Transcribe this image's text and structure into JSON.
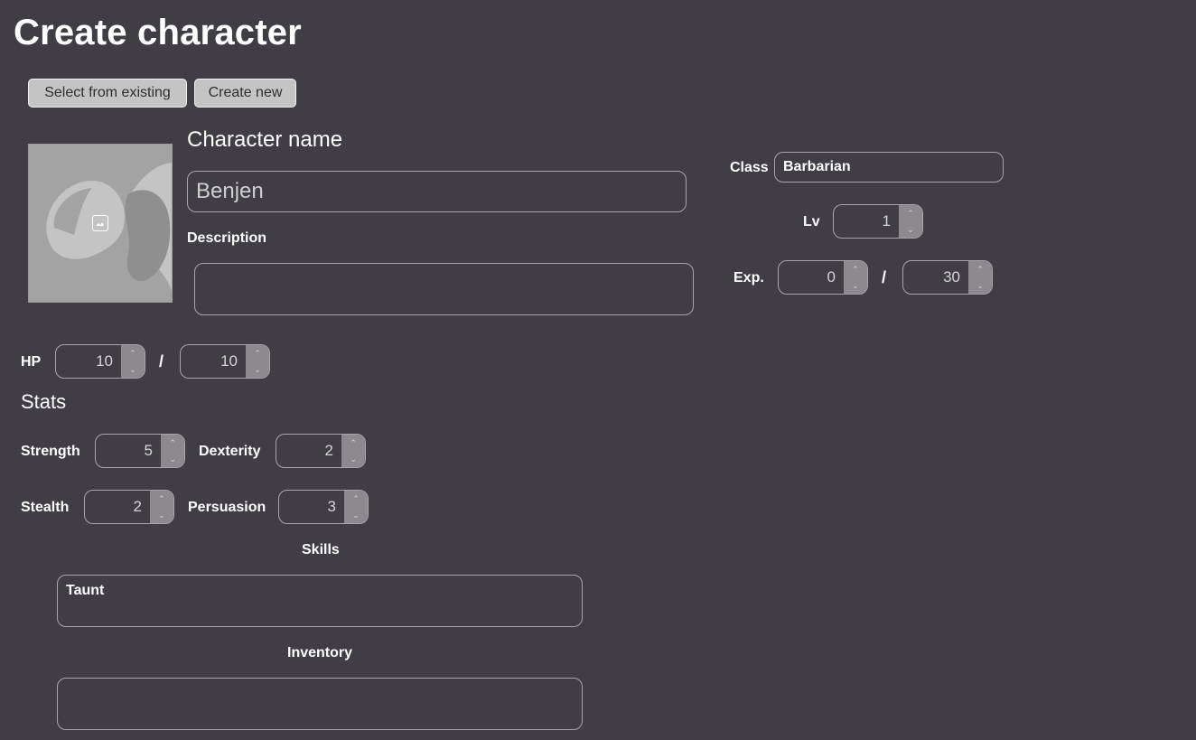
{
  "page": {
    "title": "Create character"
  },
  "source_buttons": {
    "select_existing": "Select from existing",
    "create_new": "Create new"
  },
  "portrait": {
    "icon": "image-placeholder-icon"
  },
  "name": {
    "label": "Character name",
    "value": "Benjen"
  },
  "description": {
    "label": "Description",
    "value": ""
  },
  "class": {
    "label": "Class",
    "value": "Barbarian"
  },
  "level": {
    "label": "Lv",
    "value": "1"
  },
  "exp": {
    "label": "Exp.",
    "current": "0",
    "separator": "/",
    "max": "30"
  },
  "hp": {
    "label": "HP",
    "current": "10",
    "separator": "/",
    "max": "10"
  },
  "stats": {
    "heading": "Stats",
    "strength": {
      "label": "Strength",
      "value": "5"
    },
    "dexterity": {
      "label": "Dexterity",
      "value": "2"
    },
    "stealth": {
      "label": "Stealth",
      "value": "2"
    },
    "persuasion": {
      "label": "Persuasion",
      "value": "3"
    }
  },
  "skills": {
    "label": "Skills",
    "value": "Taunt"
  },
  "inventory": {
    "label": "Inventory",
    "value": ""
  },
  "spinner": {
    "up": "⌃",
    "down": "⌄"
  },
  "colors": {
    "background": "#403e44",
    "button": "#c4c4c4",
    "border": "#a8a6ab",
    "spinner": "#8c8a8f"
  }
}
